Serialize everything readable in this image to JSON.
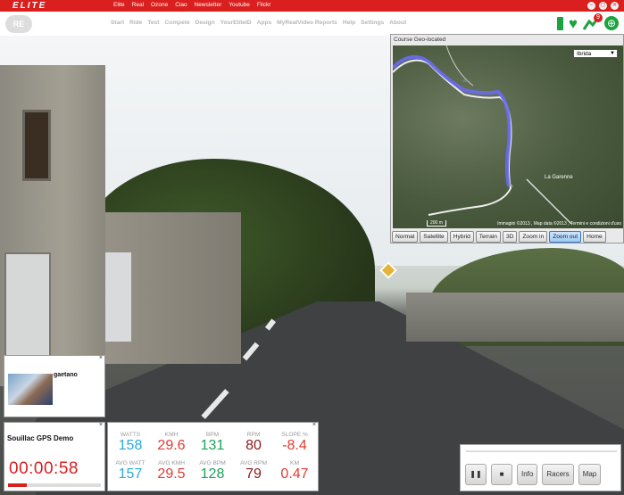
{
  "topbar": {
    "logo": "ELITE",
    "nav": [
      "Elite",
      "Real",
      "Ozone",
      "Ciao",
      "Newsletter",
      "Youtube",
      "Flickr"
    ]
  },
  "nav2": {
    "logo": "RE",
    "items": [
      "Start",
      "Ride",
      "Test",
      "Compete",
      "Design",
      "YourEliteID",
      "Apps",
      "MyRealVideo Reports",
      "Help",
      "Settings",
      "About"
    ],
    "route_badge": "9"
  },
  "map": {
    "title": "Course Geo-located",
    "layer_select": "Ibrida",
    "label_place": "La Garenne",
    "scale": "200 m",
    "attribution": "Immagini ©2013 , Map data ©2013 , Termini e condizioni d'uso",
    "buttons": [
      "Normal",
      "Satellite",
      "Hybrid",
      "Terrain",
      "3D",
      "Zoom in",
      "Zoom out",
      "Home"
    ],
    "active_button": "Zoom out"
  },
  "rider": {
    "name": "gaetano"
  },
  "course": {
    "name": "Souillac GPS Demo",
    "time": "00:00:58",
    "progress": 0.2
  },
  "stats": {
    "top": [
      {
        "label": "WATTS",
        "value": "158",
        "color": "#29a9e0"
      },
      {
        "label": "KMH",
        "value": "29.6",
        "color": "#e23a32"
      },
      {
        "label": "BPM",
        "value": "131",
        "color": "#1aa35a"
      },
      {
        "label": "RPM",
        "value": "80",
        "color": "#8c1a1a"
      },
      {
        "label": "SLOPE %",
        "value": "-8.4",
        "color": "#e23a32"
      }
    ],
    "bottom": [
      {
        "label": "AVG WATT",
        "value": "157",
        "color": "#29a9e0"
      },
      {
        "label": "AVG KMH",
        "value": "29.5",
        "color": "#e23a32"
      },
      {
        "label": "AVG BPM",
        "value": "128",
        "color": "#1aa35a"
      },
      {
        "label": "AVG RPM",
        "value": "79",
        "color": "#8c1a1a"
      },
      {
        "label": "KM",
        "value": "0.47",
        "color": "#e23a32"
      }
    ]
  },
  "controls": {
    "info": "Info",
    "racers": "Racers",
    "map": "Map"
  }
}
